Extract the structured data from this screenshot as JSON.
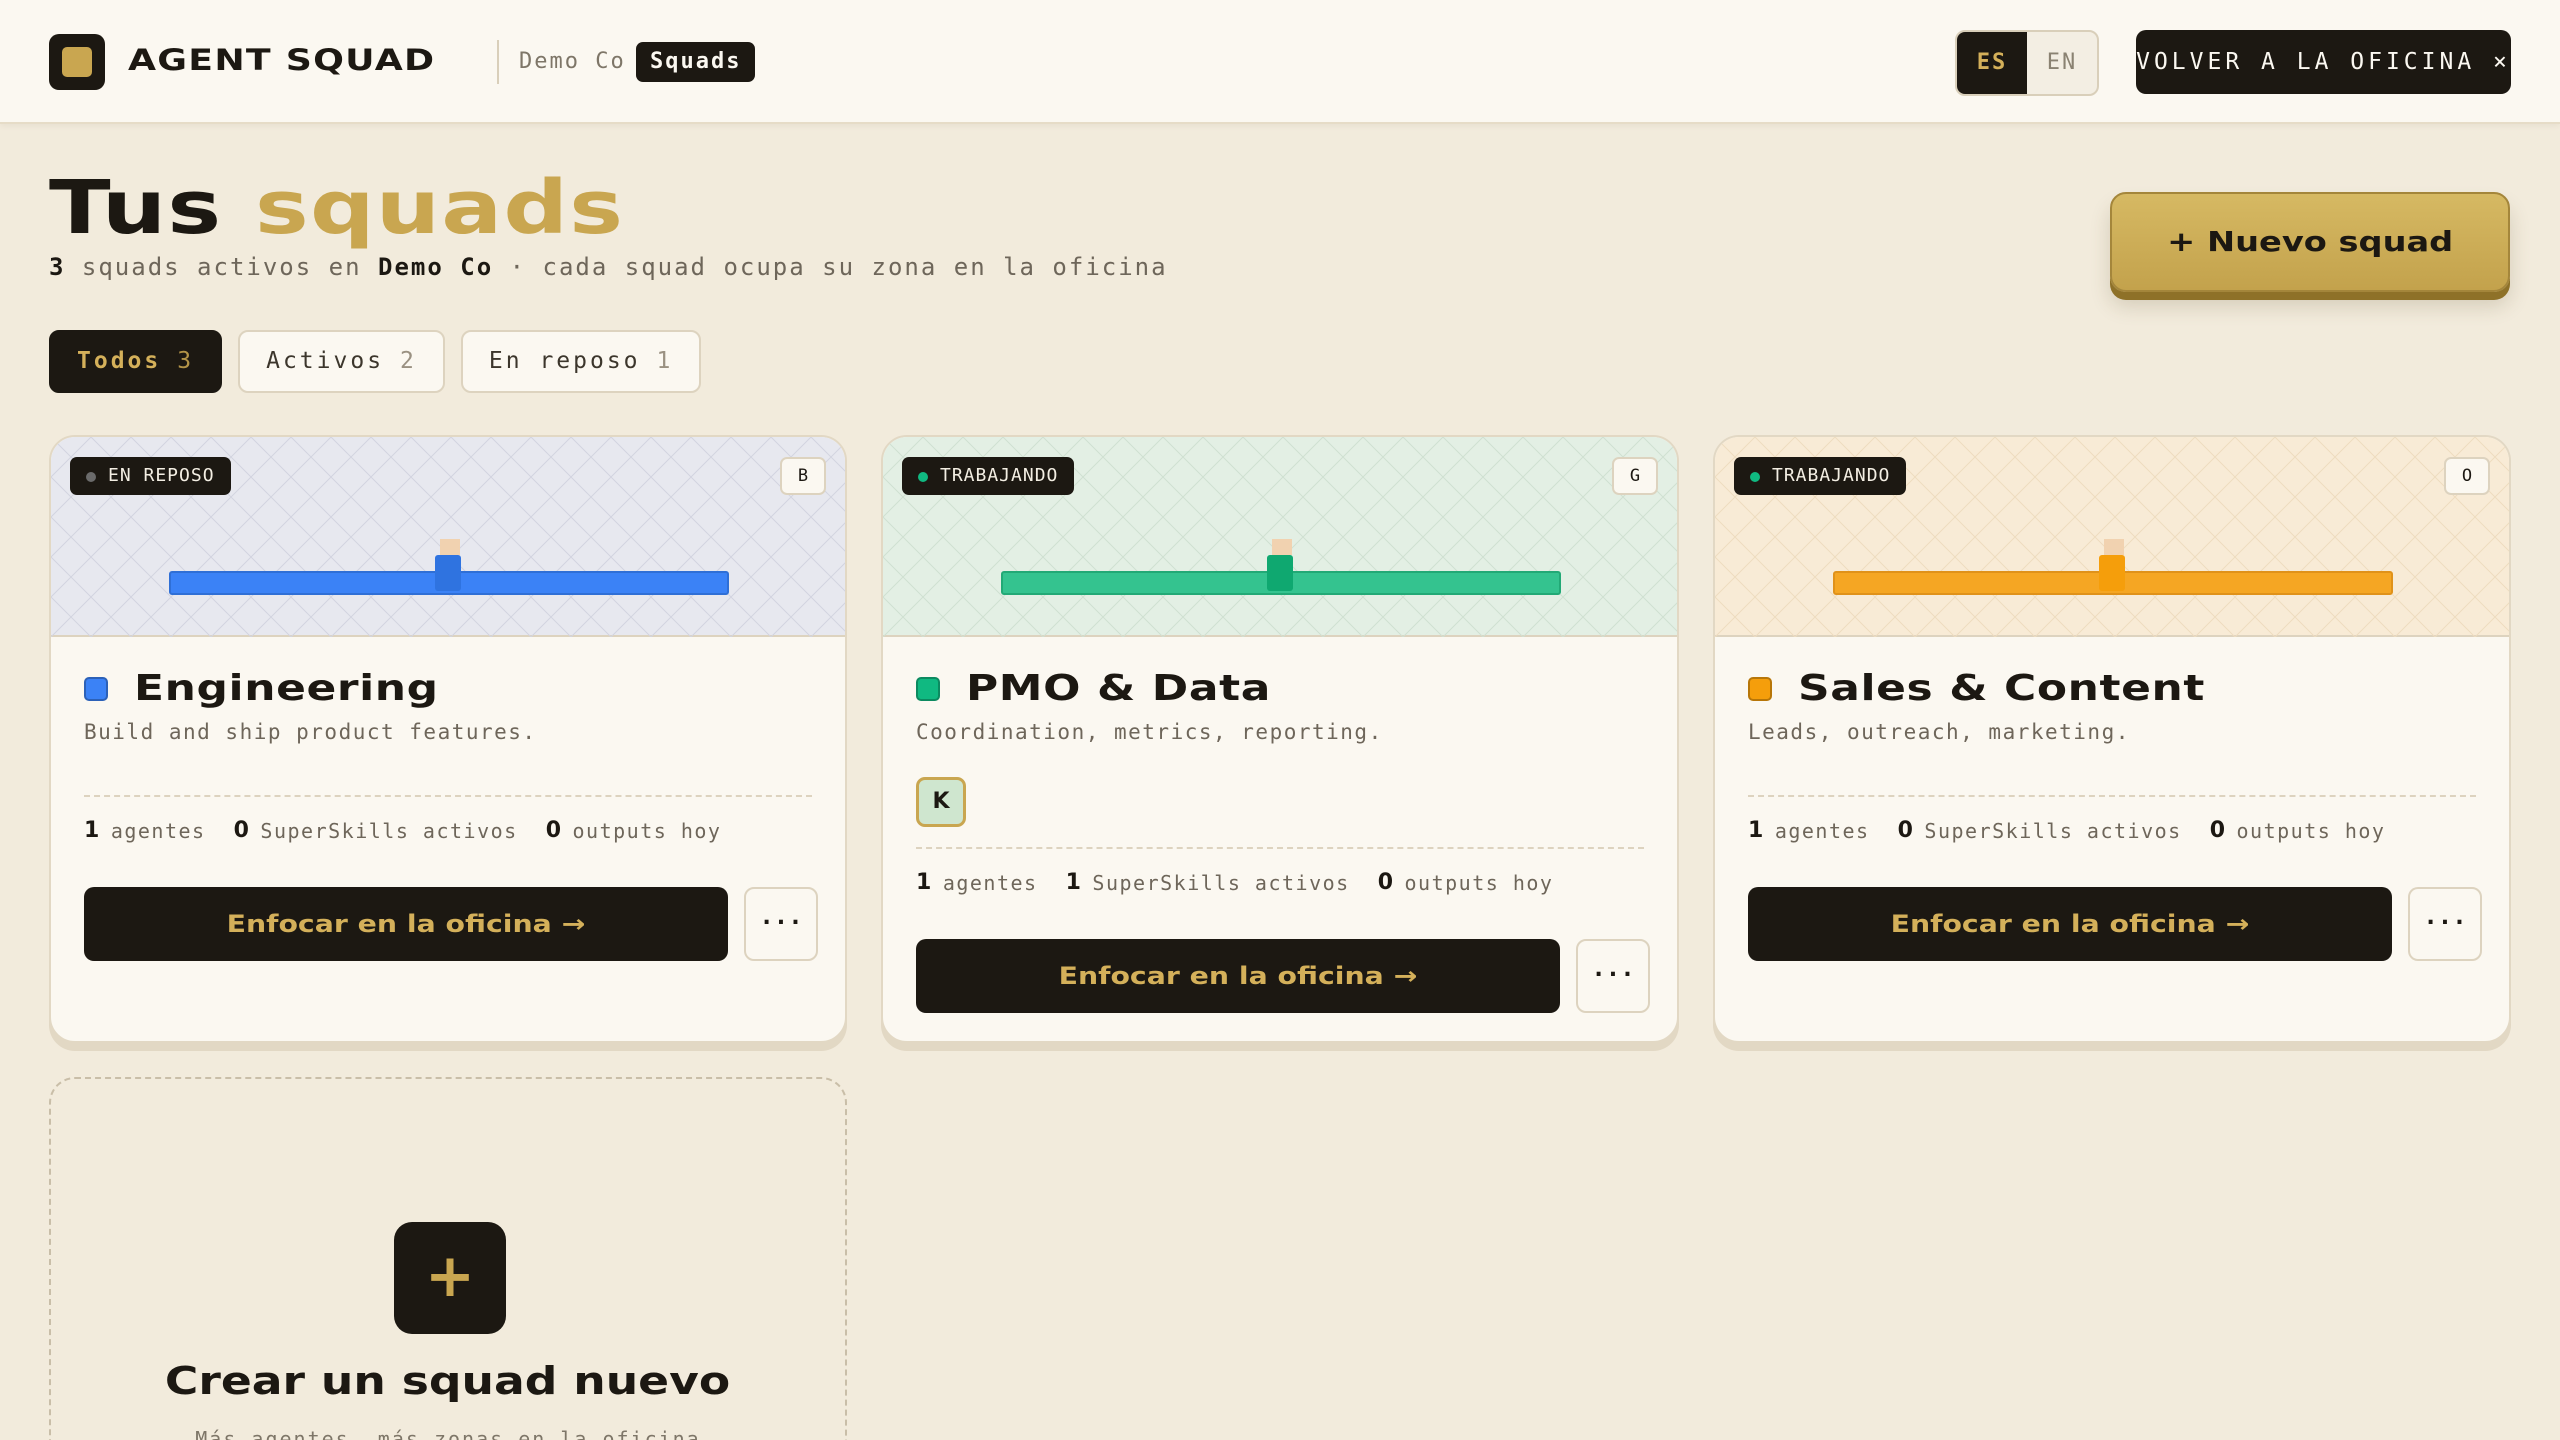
{
  "topbar": {
    "brand": "AGENT SQUAD",
    "org": "Demo Co",
    "current": "Squads",
    "lang": [
      "ES",
      "EN"
    ],
    "back_label": "VOLVER A LA OFICINA ×"
  },
  "header": {
    "title_main": "Tus",
    "title_accent": "squads",
    "subtitle_count": "3",
    "subtitle_mid": "squads activos en",
    "subtitle_org": "Demo Co",
    "subtitle_tail": "· cada squad ocupa su zona en la oficina",
    "new_button": "+ Nuevo squad"
  },
  "filters": [
    {
      "label": "Todos",
      "count": "3"
    },
    {
      "label": "Activos",
      "count": "2"
    },
    {
      "label": "En reposo",
      "count": "1"
    }
  ],
  "squads": [
    {
      "status": "EN REPOSO",
      "letter": "B",
      "name": "Engineering",
      "description": "Build and ship product features.",
      "agents": "1",
      "agents_label": "agentes",
      "skills": "0",
      "skills_label": "SuperSkills activos",
      "outputs": "0",
      "outputs_label": "outputs hoy",
      "focus_label": "Enfocar en la oficina →",
      "more_label": "···",
      "color": "#3b82f6",
      "status_color": "#6b6b6b"
    },
    {
      "status": "TRABAJANDO",
      "letter": "G",
      "name": "PMO & Data",
      "description": "Coordination, metrics, reporting.",
      "avatar": "K",
      "agents": "1",
      "agents_label": "agentes",
      "skills": "1",
      "skills_label": "SuperSkills activos",
      "outputs": "0",
      "outputs_label": "outputs hoy",
      "focus_label": "Enfocar en la oficina →",
      "more_label": "···",
      "color": "#10b981",
      "status_color": "#10b981"
    },
    {
      "status": "TRABAJANDO",
      "letter": "O",
      "name": "Sales & Content",
      "description": "Leads, outreach, marketing.",
      "agents": "1",
      "agents_label": "agentes",
      "skills": "0",
      "skills_label": "SuperSkills activos",
      "outputs": "0",
      "outputs_label": "outputs hoy",
      "focus_label": "Enfocar en la oficina →",
      "more_label": "···",
      "color": "#f59e0b",
      "status_color": "#10b981"
    }
  ],
  "create": {
    "icon": "+",
    "title": "Crear un squad nuevo",
    "subtitle": "Más agentes, más zonas en la oficina"
  }
}
